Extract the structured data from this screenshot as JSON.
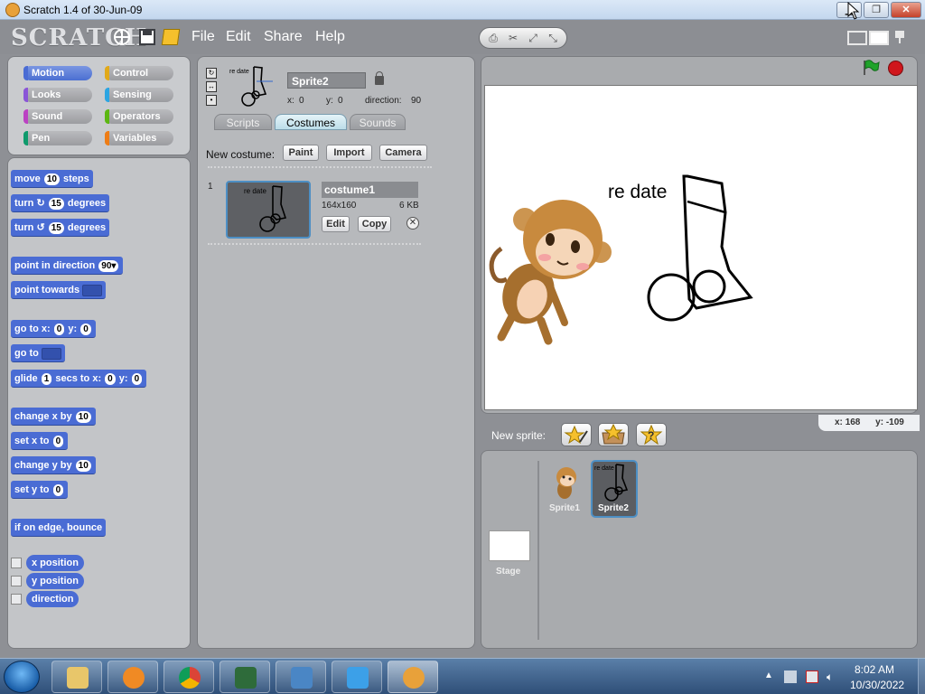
{
  "window": {
    "title": "Scratch 1.4 of 30-Jun-09",
    "minimize": "▁",
    "maximize": "❐",
    "close": "✕"
  },
  "menubar": {
    "logo": "SCRATCH",
    "items": [
      "File",
      "Edit",
      "Share",
      "Help"
    ]
  },
  "categories": [
    {
      "label": "Motion",
      "color": "#4a6cd4",
      "active": true
    },
    {
      "label": "Control",
      "color": "#e1a91a"
    },
    {
      "label": "Looks",
      "color": "#8a55d7"
    },
    {
      "label": "Sensing",
      "color": "#2ca5e2"
    },
    {
      "label": "Sound",
      "color": "#bb42c3"
    },
    {
      "label": "Operators",
      "color": "#5cb712"
    },
    {
      "label": "Pen",
      "color": "#0e9a6c"
    },
    {
      "label": "Variables",
      "color": "#ee7d16"
    }
  ],
  "blocks": {
    "move": {
      "pre": "move",
      "val": "10",
      "post": "steps"
    },
    "turn_cw": {
      "pre": "turn ↻",
      "val": "15",
      "post": "degrees"
    },
    "turn_ccw": {
      "pre": "turn ↺",
      "val": "15",
      "post": "degrees"
    },
    "point_dir": {
      "pre": "point in direction",
      "val": "90▾"
    },
    "point_towards": {
      "pre": "point towards"
    },
    "goto_xy": {
      "pre": "go to x:",
      "x": "0",
      "mid": "y:",
      "y": "0"
    },
    "goto": {
      "pre": "go to"
    },
    "glide": {
      "pre": "glide",
      "secs": "1",
      "mid1": "secs to x:",
      "x": "0",
      "mid2": "y:",
      "y": "0"
    },
    "change_x": {
      "pre": "change x by",
      "val": "10"
    },
    "set_x": {
      "pre": "set x to",
      "val": "0"
    },
    "change_y": {
      "pre": "change y by",
      "val": "10"
    },
    "set_y": {
      "pre": "set y to",
      "val": "0"
    },
    "bounce": "if on edge, bounce",
    "reporters": [
      "x position",
      "y position",
      "direction"
    ]
  },
  "sprite": {
    "name": "Sprite2",
    "x_label": "x:",
    "x": "0",
    "y_label": "y:",
    "y": "0",
    "dir_label": "direction:",
    "direction": "90"
  },
  "tabs": [
    "Scripts",
    "Costumes",
    "Sounds"
  ],
  "costumes": {
    "new_label": "New costume:",
    "buttons": [
      "Paint",
      "Import",
      "Camera"
    ],
    "item": {
      "index": "1",
      "name": "costume1",
      "size": "164x160",
      "bytes": "6 KB",
      "edit": "Edit",
      "copy": "Copy",
      "thumb_text": "re date"
    }
  },
  "stage": {
    "text": "re date",
    "mouse_x_label": "x:",
    "mouse_x": "168",
    "mouse_y_label": "y:",
    "mouse_y": "-109"
  },
  "sprite_list": {
    "new_sprite_label": "New sprite:",
    "stage_label": "Stage",
    "sprites": [
      "Sprite1",
      "Sprite2"
    ]
  },
  "taskbar": {
    "time": "8:02 AM",
    "date": "10/30/2022"
  }
}
